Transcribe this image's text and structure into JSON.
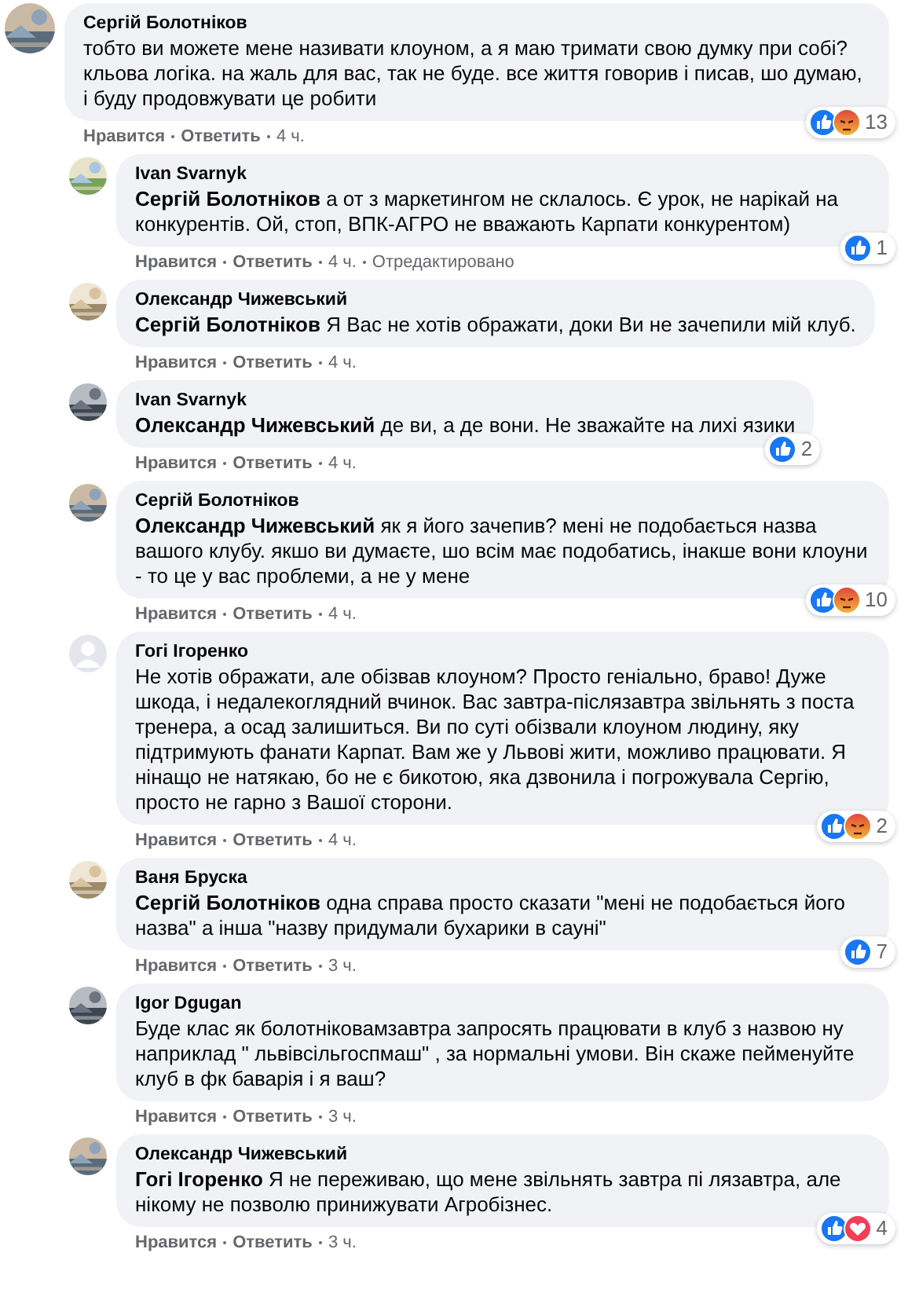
{
  "comments": [
    {
      "author": "Сергій Болотніков",
      "avatar": {
        "kind": "picture"
      },
      "text": "тобто ви можете мене називати клоуном, а я маю тримати свою думку при собі? кльова логіка. на жаль для вас, так не буде. все життя говорив і писав, шо думаю, і буду продовжувати це робити",
      "reactions": [
        {
          "kind": "like"
        },
        {
          "kind": "angry"
        }
      ],
      "reaction_count": "13",
      "meta": [
        {
          "kind": "link",
          "text": "Нравится"
        },
        {
          "kind": "link",
          "text": "Ответить"
        },
        {
          "kind": "time",
          "text": "4 ч."
        }
      ],
      "replies": [
        {
          "author": "Ivan Svarnyk",
          "avatar": {
            "kind": "picture"
          },
          "text": "**Сергій Болотніков** а от з маркетингом не склалось. Є урок, не нарікай на конкурентів. Ой, стоп, ВПК-АГРО не вважають Карпати конкурентом)",
          "reactions": [
            {
              "kind": "like"
            }
          ],
          "reaction_count": "1",
          "meta": [
            {
              "kind": "link",
              "text": "Нравится"
            },
            {
              "kind": "link",
              "text": "Ответить"
            },
            {
              "kind": "time",
              "text": "4 ч."
            },
            {
              "kind": "note",
              "text": "Отредактировано"
            }
          ]
        },
        {
          "author": "Олександр Чижевський",
          "avatar": {
            "kind": "picture"
          },
          "text": "**Сергій Болотніков** Я Вас не хотів ображати, доки Ви не зачепили мій клуб.",
          "meta": [
            {
              "kind": "link",
              "text": "Нравится"
            },
            {
              "kind": "link",
              "text": "Ответить"
            },
            {
              "kind": "time",
              "text": "4 ч."
            }
          ]
        },
        {
          "author": "Ivan Svarnyk",
          "avatar": {
            "kind": "picture"
          },
          "text": "**Олександр Чижевський** де ви, а де вони. Не зважайте на лихі язики",
          "reactions": [
            {
              "kind": "like"
            }
          ],
          "reaction_count": "2",
          "meta": [
            {
              "kind": "link",
              "text": "Нравится"
            },
            {
              "kind": "link",
              "text": "Ответить"
            },
            {
              "kind": "time",
              "text": "4 ч."
            }
          ]
        },
        {
          "author": "Сергій Болотніков",
          "avatar": {
            "kind": "picture"
          },
          "text": "**Олександр Чижевський** як я його зачепив? мені не подобається назва вашого клубу. якшо ви думаєте, шо всім має подобатись, інакше вони клоуни - то це у вас проблеми, а не у мене",
          "reactions": [
            {
              "kind": "like"
            },
            {
              "kind": "angry"
            }
          ],
          "reaction_count": "10",
          "meta": [
            {
              "kind": "link",
              "text": "Нравится"
            },
            {
              "kind": "link",
              "text": "Ответить"
            },
            {
              "kind": "time",
              "text": "4 ч."
            }
          ]
        },
        {
          "author": "Гогі Ігоренко",
          "avatar": {
            "kind": "default"
          },
          "text": "Не хотів ображати, але обізвав клоуном? Просто геніально, браво! Дуже шкода, і недалекоглядний вчинок. Вас завтра-післязавтра звільнять з поста тренера, а осад залишиться. Ви по суті обізвали клоуном людину, яку підтримують фанати Карпат. Вам же у Львові жити, можливо працювати. Я нінащо не натякаю, бо не є бикотою, яка дзвонила і погрожувала Сергію, просто не гарно з Вашої сторони.",
          "reactions": [
            {
              "kind": "like"
            },
            {
              "kind": "angry"
            }
          ],
          "reaction_count": "2",
          "meta": [
            {
              "kind": "link",
              "text": "Нравится"
            },
            {
              "kind": "link",
              "text": "Ответить"
            },
            {
              "kind": "time",
              "text": "4 ч."
            }
          ]
        },
        {
          "author": "Ваня Бруска",
          "avatar": {
            "kind": "picture"
          },
          "text": "**Сергій Болотніков** одна справа просто сказати \"мені не подобається його назва\" а інша \"назву придумали бухарики в сауні\"",
          "reactions": [
            {
              "kind": "like"
            }
          ],
          "reaction_count": "7",
          "meta": [
            {
              "kind": "link",
              "text": "Нравится"
            },
            {
              "kind": "link",
              "text": "Ответить"
            },
            {
              "kind": "time",
              "text": "3 ч."
            }
          ]
        },
        {
          "author": "Igor Dgugan",
          "avatar": {
            "kind": "picture"
          },
          "text": "Буде клас як болотніковамзавтра запросять працювати в клуб з назвою ну наприклад \" львівсільгоспмаш\" , за нормальні умови. Він скаже пейменуйте клуб в фк баварія і я ваш?",
          "meta": [
            {
              "kind": "link",
              "text": "Нравится"
            },
            {
              "kind": "link",
              "text": "Ответить"
            },
            {
              "kind": "time",
              "text": "3 ч."
            }
          ]
        },
        {
          "author": "Олександр Чижевський",
          "avatar": {
            "kind": "picture"
          },
          "text": "**Гогі Ігоренко** Я не переживаю, що мене звільнять завтра пі лязавтра, але нікому не позволю принижувати Агробізнес.",
          "reactions": [
            {
              "kind": "like"
            },
            {
              "kind": "love"
            }
          ],
          "reaction_count": "4",
          "meta": [
            {
              "kind": "link",
              "text": "Нравится"
            },
            {
              "kind": "link",
              "text": "Ответить"
            },
            {
              "kind": "time",
              "text": "3 ч."
            }
          ]
        }
      ]
    }
  ]
}
